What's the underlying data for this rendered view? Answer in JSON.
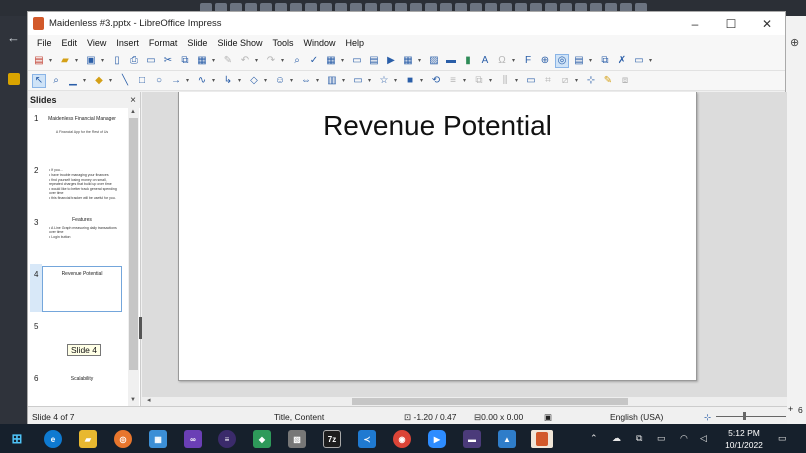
{
  "window": {
    "title": "Maidenless #3.pptx - LibreOffice Impress",
    "controls": [
      "–",
      "☐",
      "✕"
    ]
  },
  "menubar": [
    "File",
    "Edit",
    "View",
    "Insert",
    "Format",
    "Slide",
    "Slide Show",
    "Tools",
    "Window",
    "Help"
  ],
  "slides_pane": {
    "title": "Slides",
    "close": "×",
    "slides": [
      {
        "num": "1",
        "title": "Maidenless Financial Manager",
        "subtitle": "A Financial App for the Rest of Us",
        "bullets": []
      },
      {
        "num": "2",
        "title": "",
        "subtitle": "",
        "bullets": [
          "If you...",
          "have trouble managing your finances",
          "find yourself losing money on small, repeated charges that build up over time",
          "would like to better track general spending over time",
          "this financial tracker will be useful for you."
        ]
      },
      {
        "num": "3",
        "title": "Features",
        "subtitle": "",
        "bullets": [
          "A Line Graph measuring daily transactions over time",
          "Login button"
        ]
      },
      {
        "num": "4",
        "title": "Revenue Potential",
        "subtitle": "",
        "bullets": []
      },
      {
        "num": "5",
        "title": "",
        "subtitle": "",
        "bullets": []
      },
      {
        "num": "6",
        "title": "Scalability",
        "subtitle": "",
        "bullets": []
      }
    ],
    "tooltip": "Slide 4"
  },
  "slide": {
    "title": "Revenue Potential"
  },
  "statusbar": {
    "slide_counter": "Slide 4 of 7",
    "layout": "Title, Content",
    "position": "-1.20 / 0.47",
    "size": "0.00 x 0.00",
    "language": "English (USA)",
    "zoom_plus": "+",
    "zoom_value": "6"
  },
  "taskbar": {
    "time": "5:12 PM",
    "date": "10/1/2022",
    "apps": [
      "start",
      "edge",
      "file-explorer",
      "app-orange",
      "app-blue",
      "visual-studio",
      "app-purple",
      "app-git",
      "app-gray",
      "7zip",
      "vscode",
      "chrome",
      "zoom",
      "terminal",
      "photos",
      "impress"
    ],
    "seven_zip_label": "7z"
  },
  "colors": {
    "accent": "#2a5ea8",
    "selection": "#74a6db",
    "taskbar": "#16202c"
  }
}
